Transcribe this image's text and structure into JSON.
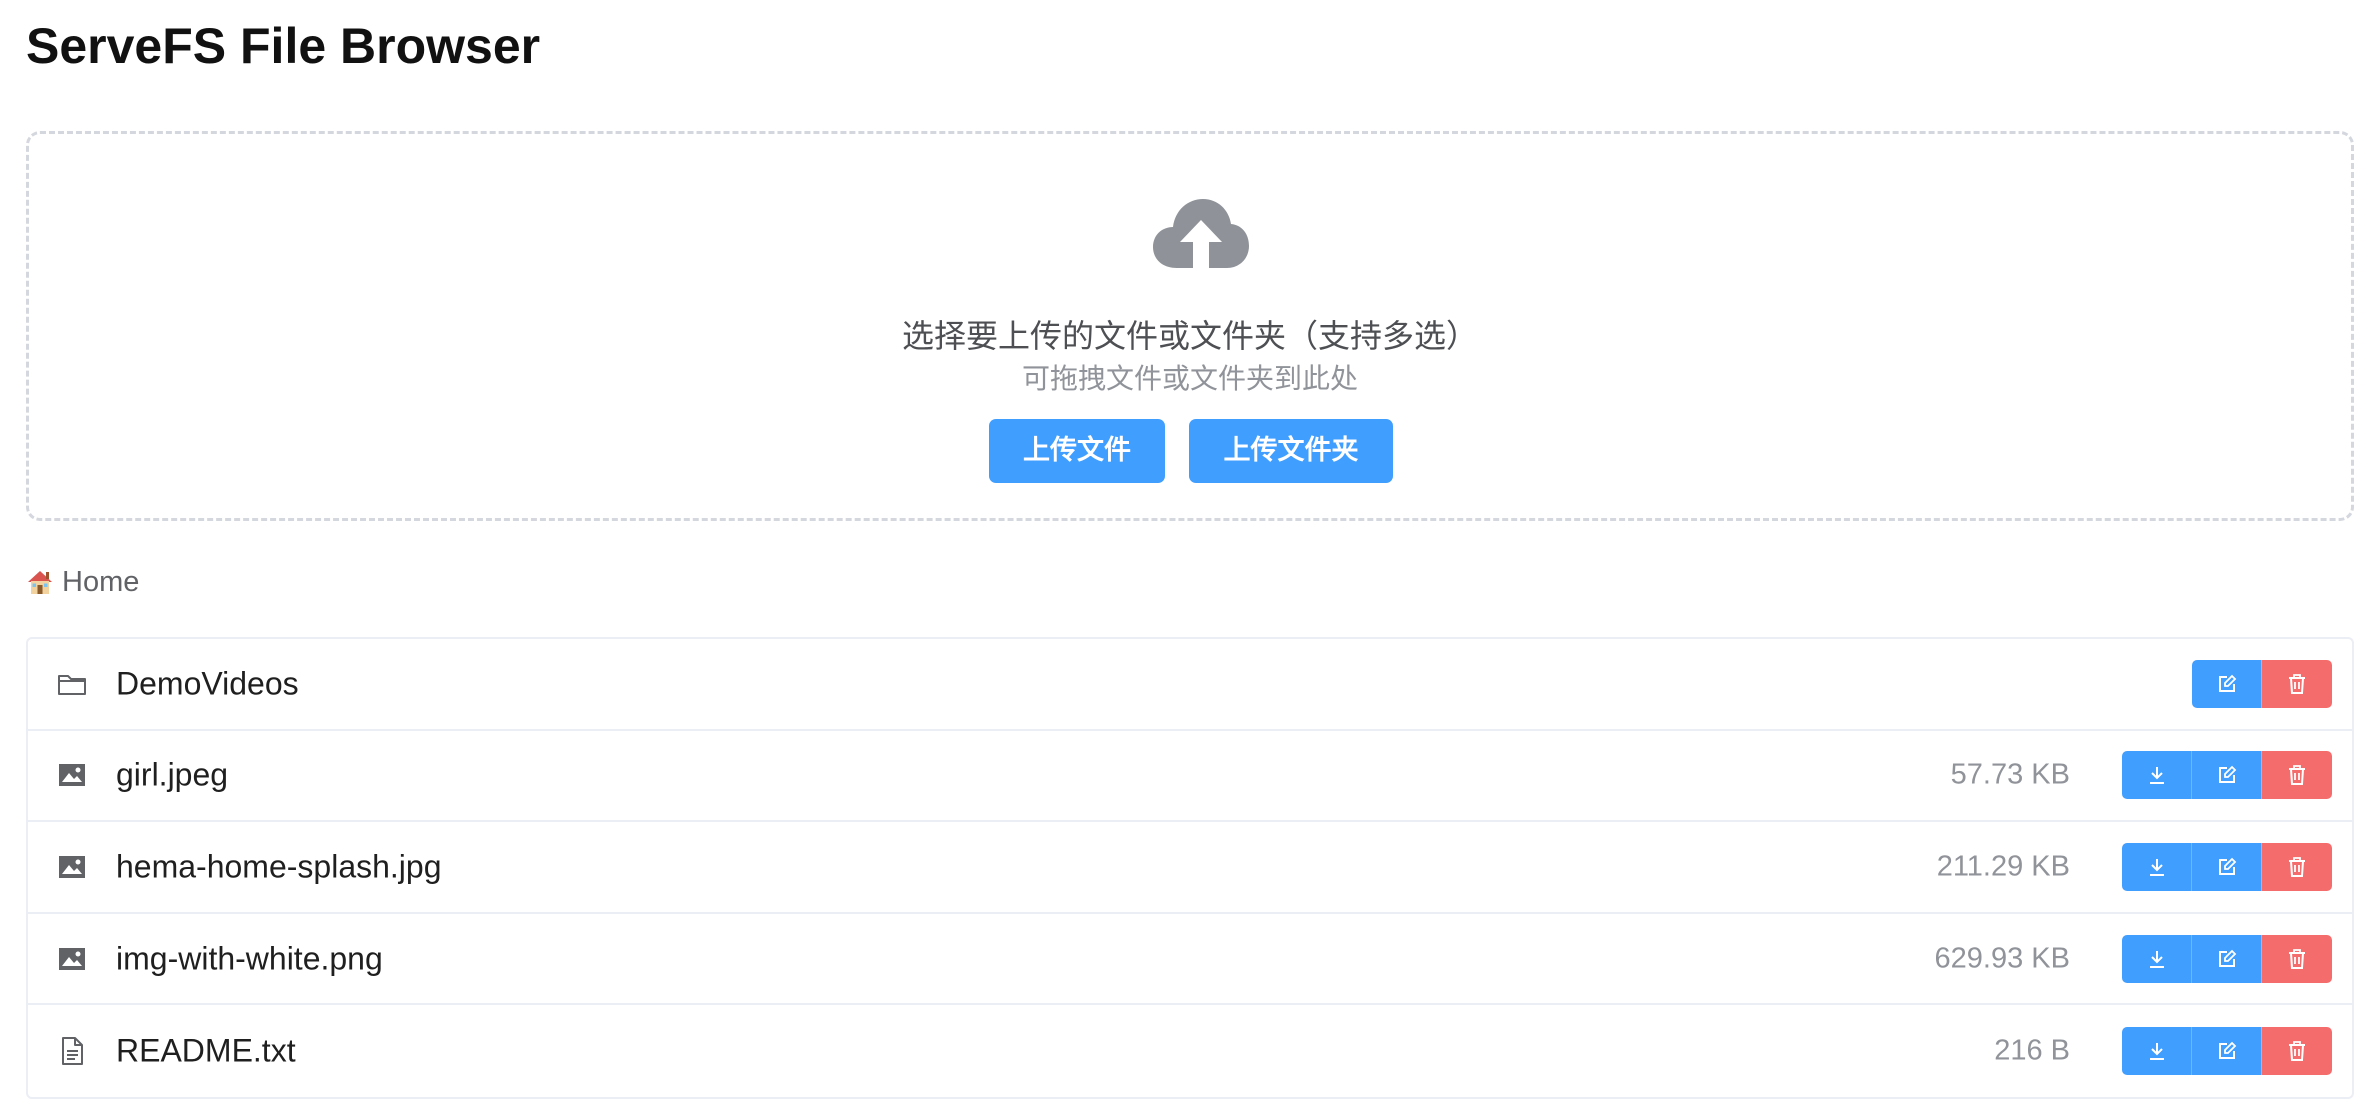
{
  "app": {
    "title": "ServeFS File Browser"
  },
  "upload": {
    "title": "选择要上传的文件或文件夹（支持多选）",
    "hint": "可拖拽文件或文件夹到此处",
    "upload_files_label": "上传文件",
    "upload_folder_label": "上传文件夹",
    "icon": "cloud-upload-icon"
  },
  "breadcrumb": {
    "home_label": "Home",
    "icon": "house-icon"
  },
  "files": [
    {
      "name": "DemoVideos",
      "size": "",
      "type": "folder",
      "icon": "folder-icon"
    },
    {
      "name": "girl.jpeg",
      "size": "57.73 KB",
      "type": "image",
      "icon": "image-icon"
    },
    {
      "name": "hema-home-splash.jpg",
      "size": "211.29 KB",
      "type": "image",
      "icon": "image-icon"
    },
    {
      "name": "img-with-white.png",
      "size": "629.93 KB",
      "type": "image",
      "icon": "image-icon"
    },
    {
      "name": "README.txt",
      "size": "216 B",
      "type": "text",
      "icon": "document-icon"
    }
  ],
  "colors": {
    "primary": "#409eff",
    "danger": "#f56c6c",
    "muted_text": "#909399",
    "border": "#ebeef5"
  }
}
